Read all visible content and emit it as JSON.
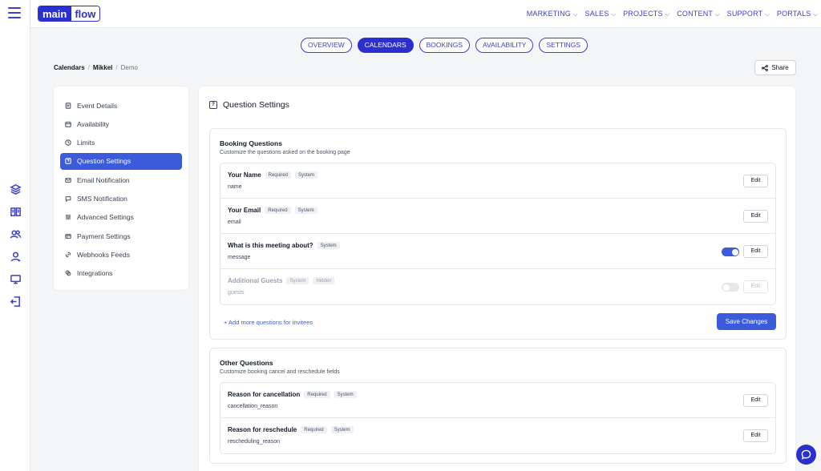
{
  "brand": {
    "main": "main",
    "flow": "flow"
  },
  "topnav": [
    {
      "label": "MARKETING"
    },
    {
      "label": "SALES"
    },
    {
      "label": "PROJECTS"
    },
    {
      "label": "CONTENT"
    },
    {
      "label": "SUPPORT"
    },
    {
      "label": "PORTALS"
    }
  ],
  "tabs": [
    {
      "label": "OVERVIEW"
    },
    {
      "label": "CALENDARS"
    },
    {
      "label": "BOOKINGS"
    },
    {
      "label": "AVAILABILITY"
    },
    {
      "label": "SETTINGS"
    }
  ],
  "active_tab": "CALENDARS",
  "breadcrumb": {
    "root": "Calendars",
    "user": "Mikkel",
    "current": "Demo"
  },
  "share_label": "Share",
  "menu": [
    {
      "label": "Event Details",
      "icon": "document-icon"
    },
    {
      "label": "Availability",
      "icon": "calendar-icon"
    },
    {
      "label": "Limits",
      "icon": "clock-icon"
    },
    {
      "label": "Question Settings",
      "icon": "question-icon",
      "active": true
    },
    {
      "label": "Email Notification",
      "icon": "mail-icon"
    },
    {
      "label": "SMS Notification",
      "icon": "message-icon"
    },
    {
      "label": "Advanced Settings",
      "icon": "sliders-icon"
    },
    {
      "label": "Payment Settings",
      "icon": "card-icon"
    },
    {
      "label": "Webhooks Feeds",
      "icon": "link-icon"
    },
    {
      "label": "Integrations",
      "icon": "layers-icon"
    }
  ],
  "main": {
    "title": "Question Settings",
    "booking": {
      "title": "Booking Questions",
      "subtitle": "Customize the questions asked on the booking page",
      "questions": [
        {
          "name": "Your Name",
          "badges": [
            "Required",
            "System"
          ],
          "field": "name",
          "edit": "Edit"
        },
        {
          "name": "Your Email",
          "badges": [
            "Required",
            "System"
          ],
          "field": "email",
          "edit": "Edit"
        },
        {
          "name": "What is this meeting about?",
          "badges": [
            "System"
          ],
          "field": "message",
          "edit": "Edit",
          "toggle": true
        },
        {
          "name": "Additional Guests",
          "badges": [
            "System",
            "Hidden"
          ],
          "field": "guests",
          "edit": "Edit",
          "toggle": false
        }
      ],
      "add_link": "+ Add more questions for invitees",
      "save_label": "Save Changes"
    },
    "other": {
      "title": "Other Questions",
      "subtitle": "Customize booking cancel and reschedule fields",
      "questions": [
        {
          "name": "Reason for cancellation",
          "badges": [
            "Required",
            "System"
          ],
          "field": "cancellation_reason",
          "edit": "Edit"
        },
        {
          "name": "Reason for reschedule",
          "badges": [
            "Required",
            "System"
          ],
          "field": "rescheduling_reason",
          "edit": "Edit"
        }
      ]
    }
  },
  "colors": {
    "brand": "#2a2fd0",
    "accent": "#3b5bdb"
  }
}
